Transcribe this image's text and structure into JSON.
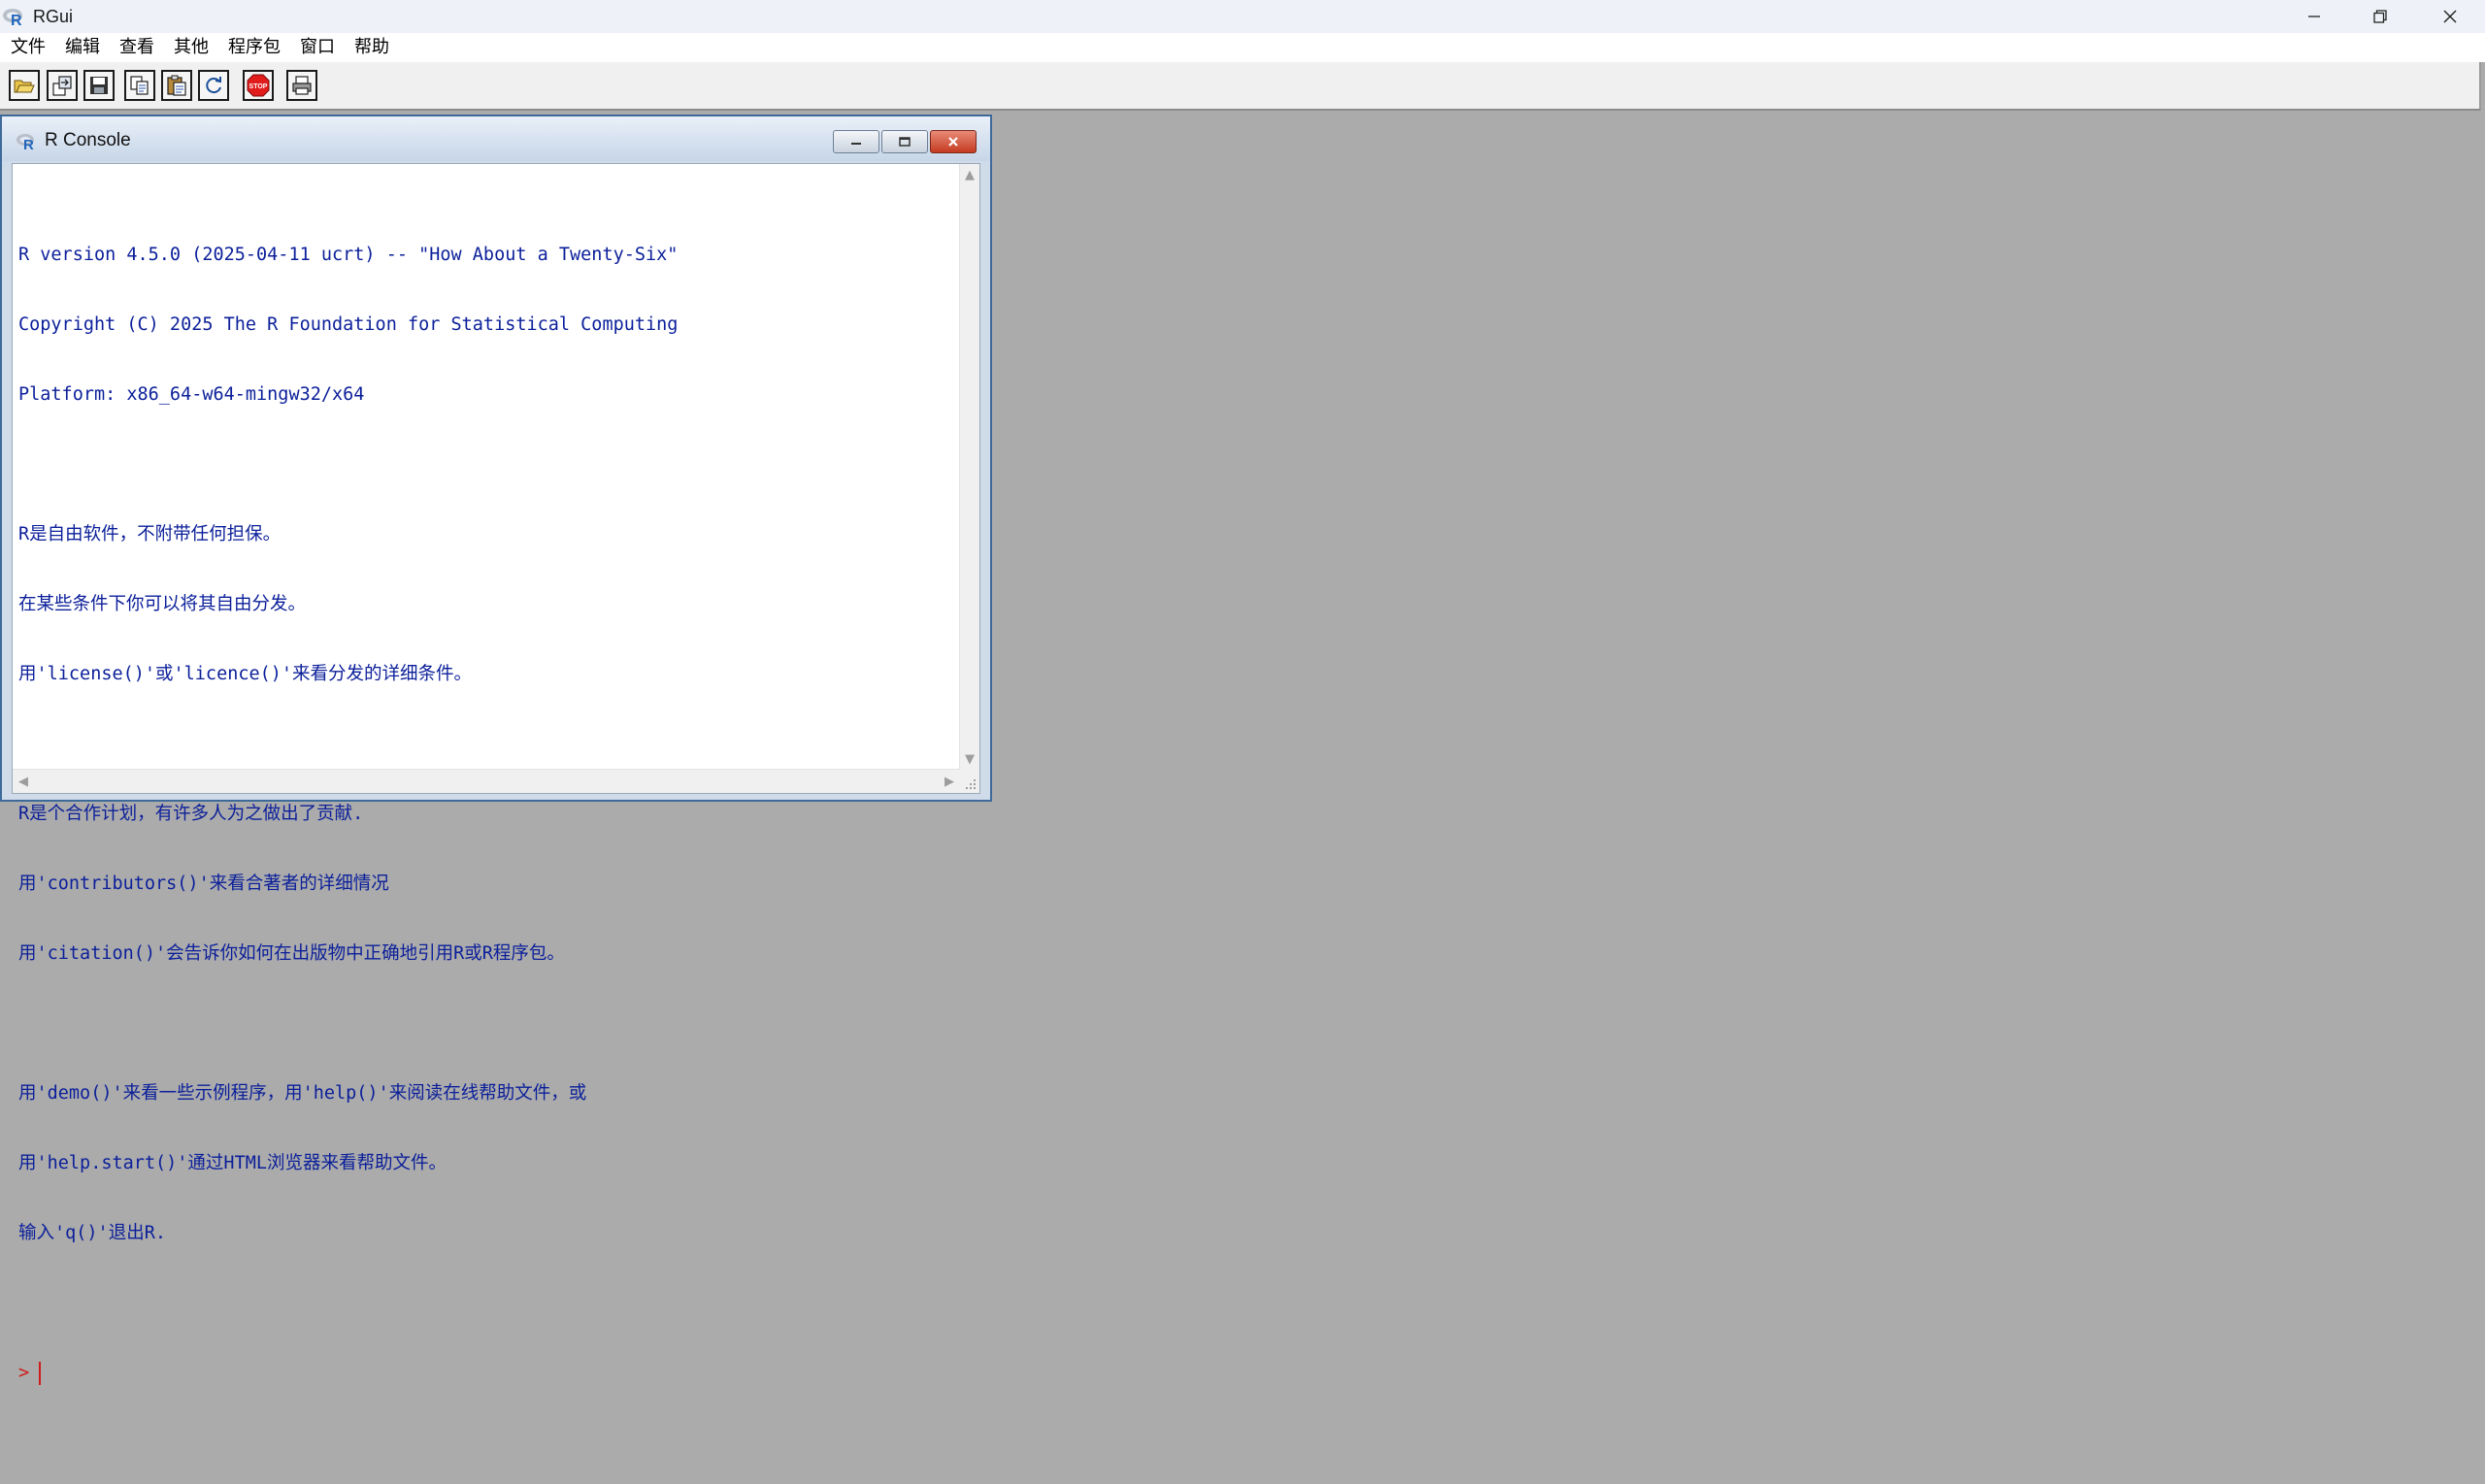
{
  "app": {
    "title": "RGui",
    "logo_icon": "r-logo-icon",
    "controls": [
      "minimize-icon",
      "restore-icon",
      "close-icon"
    ]
  },
  "menu": {
    "items": [
      "文件",
      "编辑",
      "查看",
      "其他",
      "程序包",
      "窗口",
      "帮助"
    ]
  },
  "toolbar": {
    "buttons": [
      {
        "name": "open-script-button",
        "icon": "open-folder-icon"
      },
      {
        "name": "load-workspace-button",
        "icon": "load-workspace-icon"
      },
      {
        "name": "save-workspace-button",
        "icon": "floppy-disk-icon"
      },
      {
        "name": "copy-button",
        "icon": "copy-icon"
      },
      {
        "name": "paste-button",
        "icon": "paste-icon"
      },
      {
        "name": "copy-paste-button",
        "icon": "refresh-icon"
      },
      {
        "name": "stop-button",
        "icon": "stop-icon",
        "label": "STOP"
      },
      {
        "name": "print-button",
        "icon": "printer-icon"
      }
    ]
  },
  "console": {
    "title": "R Console",
    "lines": [
      "R version 4.5.0 (2025-04-11 ucrt) -- \"How About a Twenty-Six\"",
      "Copyright (C) 2025 The R Foundation for Statistical Computing",
      "Platform: x86_64-w64-mingw32/x64",
      "",
      "R是自由软件，不附带任何担保。",
      "在某些条件下你可以将其自由分发。",
      "用'license()'或'licence()'来看分发的详细条件。",
      "",
      "R是个合作计划，有许多人为之做出了贡献.",
      "用'contributors()'来看合著者的详细情况",
      "用'citation()'会告诉你如何在出版物中正确地引用R或R程序包。",
      "",
      "用'demo()'来看一些示例程序，用'help()'来阅读在线帮助文件，或",
      "用'help.start()'通过HTML浏览器来看帮助文件。",
      "输入'q()'退出R."
    ],
    "prompt": ">"
  },
  "colors": {
    "console_output": "#0b1f9a",
    "prompt": "#d11b1b",
    "mdi_background": "#ababab"
  }
}
